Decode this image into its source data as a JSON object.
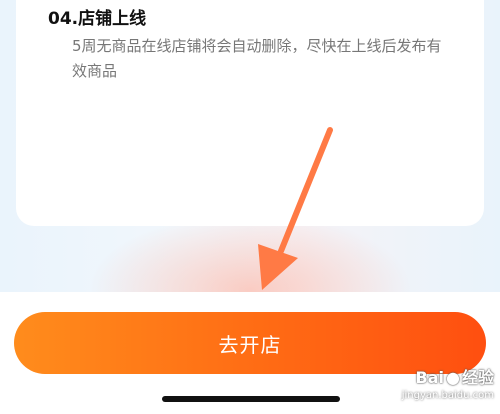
{
  "step": {
    "title": "04.店铺上线",
    "description": "5周无商品在线店铺将会自动删除，尽快在上线后发布有效商品"
  },
  "cta": {
    "label": "去开店"
  },
  "watermark": {
    "logo_text": "Bai",
    "logo_text_end": "经验",
    "url": "jingyan.baidu.com"
  },
  "colors": {
    "accent_start": "#ff8c1c",
    "accent_end": "#ff4f10",
    "annotation_arrow": "#ff7a45"
  },
  "icons": {
    "annotation": "arrow-pointer-icon",
    "watermark": "baidu-paw-icon"
  }
}
